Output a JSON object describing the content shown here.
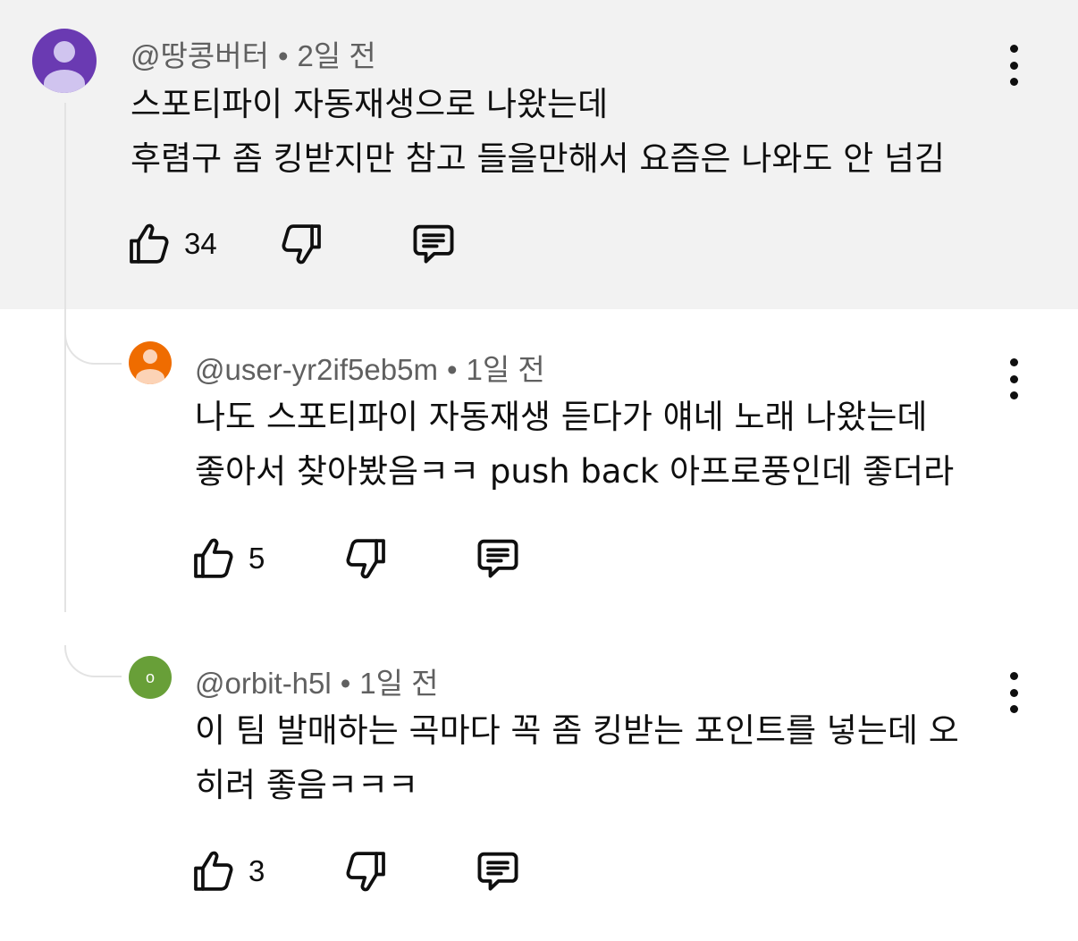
{
  "comments": [
    {
      "author": "@땅콩버터",
      "time": "2일 전",
      "lines": [
        "스포티파이 자동재생으로 나왔는데",
        "후렴구 좀 킹받지만 참고 들을만해서 요즘은 나와도 안 넘김"
      ],
      "likes": "34",
      "avatar": {
        "type": "default-person-icon",
        "bg": "#6a3ab2"
      }
    },
    {
      "author": "@user-yr2if5eb5m",
      "time": "1일 전",
      "lines": [
        "나도 스포티파이 자동재생 듣다가 얘네 노래 나왔는데",
        "좋아서 찾아봤음ㅋㅋ push back 아프로풍인데 좋더라"
      ],
      "likes": "5",
      "avatar": {
        "type": "default-person-icon",
        "bg": "#ef6c00"
      }
    },
    {
      "author": "@orbit-h5l",
      "time": "1일 전",
      "lines": [
        "이 팀 발매하는 곡마다 꼭 좀 킹받는 포인트를 넣는데 오",
        "히려 좋음ㅋㅋㅋ"
      ],
      "likes": "3",
      "avatar": {
        "type": "letter",
        "letter": "o",
        "bg": "#689f38"
      }
    }
  ],
  "separator": "•",
  "icons": {
    "like": "thumb-up-icon",
    "dislike": "thumb-down-icon",
    "reply": "reply-comment-icon",
    "menu": "more-vert-icon"
  }
}
